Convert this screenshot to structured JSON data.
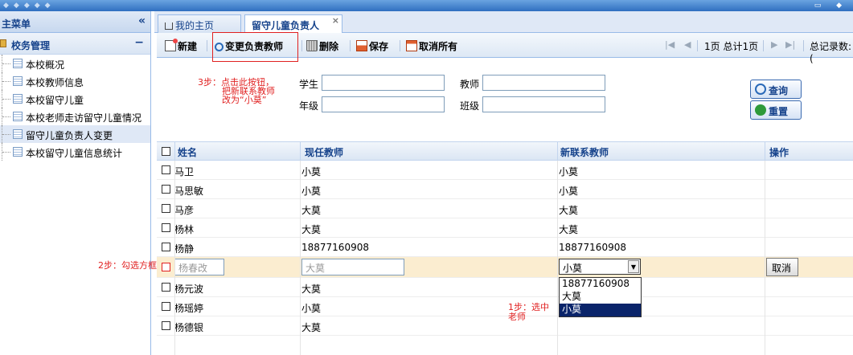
{
  "topbar": {
    "left_glyphs": "◆◆◆◆◆",
    "right_glyphs": "▭ ◆"
  },
  "sidebar": {
    "title": "主菜单",
    "collapse_glyph": "«",
    "group": {
      "label": "校务管理",
      "toggle": "−"
    },
    "items": [
      {
        "label": "本校概况"
      },
      {
        "label": "本校教师信息"
      },
      {
        "label": "本校留守儿童"
      },
      {
        "label": "本校老师走访留守儿童情况"
      },
      {
        "label": "留守儿童负责人变更"
      },
      {
        "label": "本校留守儿童信息统计"
      }
    ]
  },
  "tabs": [
    {
      "label": "我的主页"
    },
    {
      "label": "留守儿童负责人",
      "close": "×"
    }
  ],
  "toolbar": {
    "new_label": "新建",
    "change_label": "变更负责教师",
    "delete_label": "删除",
    "save_label": "保存",
    "cancel_all_label": "取消所有",
    "pager": {
      "first": "|◀",
      "prev": "◀",
      "page_text": "1页 总计1页",
      "next": "▶",
      "last": "▶|",
      "total_text": "总记录数:("
    }
  },
  "annotations": {
    "step3": [
      "3步：点击此按钮，",
      "把新联系教师",
      "改为“小莫”"
    ],
    "step2": "2步：勾选方框",
    "step1": [
      "1步：选中",
      "老师"
    ]
  },
  "search": {
    "student_label": "学生",
    "teacher_label": "教师",
    "grade_label": "年级",
    "class_label": "班级",
    "query_button": "查询",
    "reset_button": "重置"
  },
  "grid": {
    "columns": [
      "姓名",
      "现任教师",
      "新联系教师",
      "操作"
    ],
    "rows": [
      {
        "name": "马卫",
        "current": "小莫",
        "new": "小莫"
      },
      {
        "name": "马思敏",
        "current": "小莫",
        "new": "小莫"
      },
      {
        "name": "马彦",
        "current": "大莫",
        "new": "大莫"
      },
      {
        "name": "杨林",
        "current": "大莫",
        "new": "大莫"
      },
      {
        "name": "杨静",
        "current": "18877160908",
        "new": "18877160908"
      }
    ],
    "editing_row": {
      "name_value": "杨春改",
      "current_value": "大莫",
      "new_select_value": "小莫",
      "cancel_button": "取消"
    },
    "rows_after": [
      {
        "name": "杨元波",
        "current": "大莫"
      },
      {
        "name": "杨瑶婷",
        "current": "小莫"
      },
      {
        "name": "杨德银",
        "current": "大莫"
      }
    ],
    "dropdown_options": [
      "18877160908",
      "大莫",
      "小莫"
    ],
    "dropdown_selected_index": 2
  }
}
